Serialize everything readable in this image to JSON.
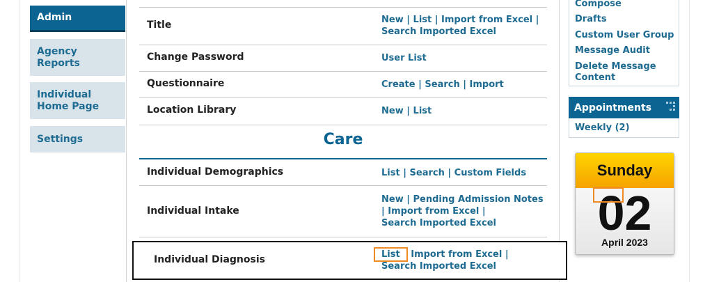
{
  "left_nav": {
    "admin": "Admin",
    "agency_reports": "Agency\nReports",
    "individual_home_page": "Individual\nHome Page",
    "settings": "Settings"
  },
  "rows": {
    "title": {
      "label": "Title",
      "l1": "New",
      "l2": "List",
      "l3": "Import from Excel",
      "l4": "Search Imported Excel"
    },
    "change_password": {
      "label": "Change Password",
      "l1": "User List"
    },
    "questionnaire": {
      "label": "Questionnaire",
      "l1": "Create",
      "l2": "Search",
      "l3": "Import"
    },
    "location_library": {
      "label": "Location Library",
      "l1": "New",
      "l2": "List"
    }
  },
  "care": {
    "section_title": "Care",
    "demographics": {
      "label": "Individual Demographics",
      "l1": "List",
      "l2": "Search",
      "l3": "Custom Fields"
    },
    "intake": {
      "label": "Individual Intake",
      "l1": "New",
      "l2": "Pending Admission Notes",
      "l3": "Import from Excel",
      "l4": "Search Imported Excel"
    },
    "diagnosis": {
      "label": "Individual Diagnosis",
      "l1": "List",
      "l2": "Import from Excel",
      "l3": "Search Imported Excel"
    }
  },
  "separator": "|",
  "messages": {
    "compose": "Compose",
    "drafts": "Drafts",
    "custom_user_group": "Custom User Group",
    "message_audit": "Message Audit",
    "delete_message_content": "Delete Message\nContent"
  },
  "appointments": {
    "title": "Appointments",
    "weekly": "Weekly (2)"
  },
  "calendar": {
    "weekday": "Sunday",
    "day": "02",
    "month_year": "April 2023"
  }
}
